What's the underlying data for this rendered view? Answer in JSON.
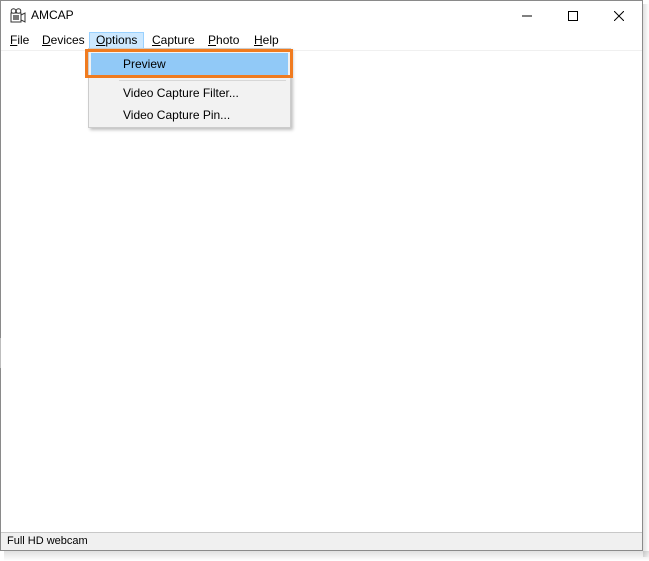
{
  "window": {
    "title": "AMCAP",
    "app_icon": "camera-icon",
    "controls": [
      "minimize-icon",
      "maximize-icon",
      "close-icon"
    ]
  },
  "menubar": {
    "items": [
      {
        "label": "File",
        "accel": "F",
        "rest": "ile"
      },
      {
        "label": "Devices",
        "accel": "D",
        "rest": "evices"
      },
      {
        "label": "Options",
        "accel": "O",
        "rest": "ptions",
        "active": true
      },
      {
        "label": "Capture",
        "accel": "C",
        "rest": "apture"
      },
      {
        "label": "Photo",
        "accel": "P",
        "rest": "hoto"
      },
      {
        "label": "Help",
        "accel": "H",
        "rest": "elp"
      }
    ]
  },
  "dropdown": {
    "items": [
      {
        "label": "Preview",
        "highlighted": true
      },
      {
        "label": "Video Capture Filter..."
      },
      {
        "label": "Video Capture Pin..."
      }
    ]
  },
  "callout": {
    "color": "#f07b1f",
    "target": "Preview"
  },
  "statusbar": {
    "text": "Full HD webcam"
  },
  "colors": {
    "menu_active_bg": "#cce8ff",
    "dropdown_highlight": "#91c9f7",
    "callout_border": "#f07b1f"
  }
}
